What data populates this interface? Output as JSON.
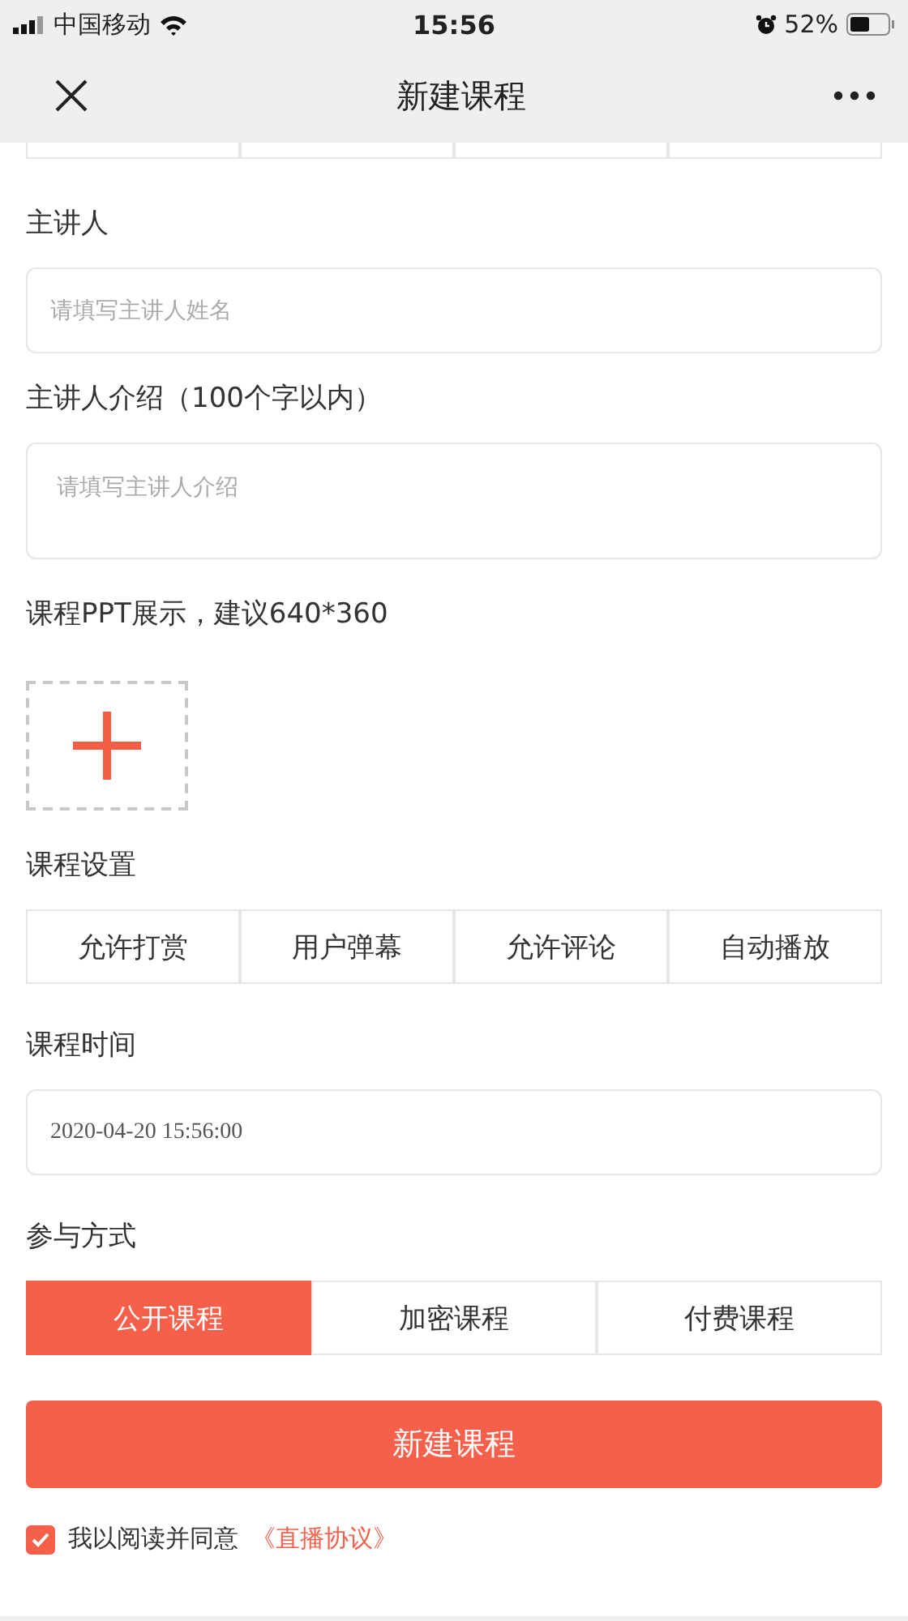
{
  "status_bar": {
    "carrier": "中国移动",
    "time": "15:56",
    "battery": "52%"
  },
  "nav": {
    "title": "新建课程"
  },
  "speaker": {
    "label": "主讲人",
    "placeholder": "请填写主讲人姓名"
  },
  "intro": {
    "label": "主讲人介绍（100个字以内）",
    "placeholder": "请填写主讲人介绍"
  },
  "ppt": {
    "label": "课程PPT展示，建议640*360"
  },
  "settings": {
    "label": "课程设置",
    "options": [
      {
        "label": "允许打赏"
      },
      {
        "label": "用户弹幕"
      },
      {
        "label": "允许评论"
      },
      {
        "label": "自动播放"
      }
    ]
  },
  "time": {
    "label": "课程时间",
    "value": "2020-04-20 15:56:00"
  },
  "mode": {
    "label": "参与方式",
    "options": [
      {
        "label": "公开课程",
        "selected": true
      },
      {
        "label": "加密课程",
        "selected": false
      },
      {
        "label": "付费课程",
        "selected": false
      }
    ]
  },
  "submit": "新建课程",
  "agreement": {
    "checked": true,
    "text": "我以阅读并同意",
    "link": "《直播协议》"
  }
}
